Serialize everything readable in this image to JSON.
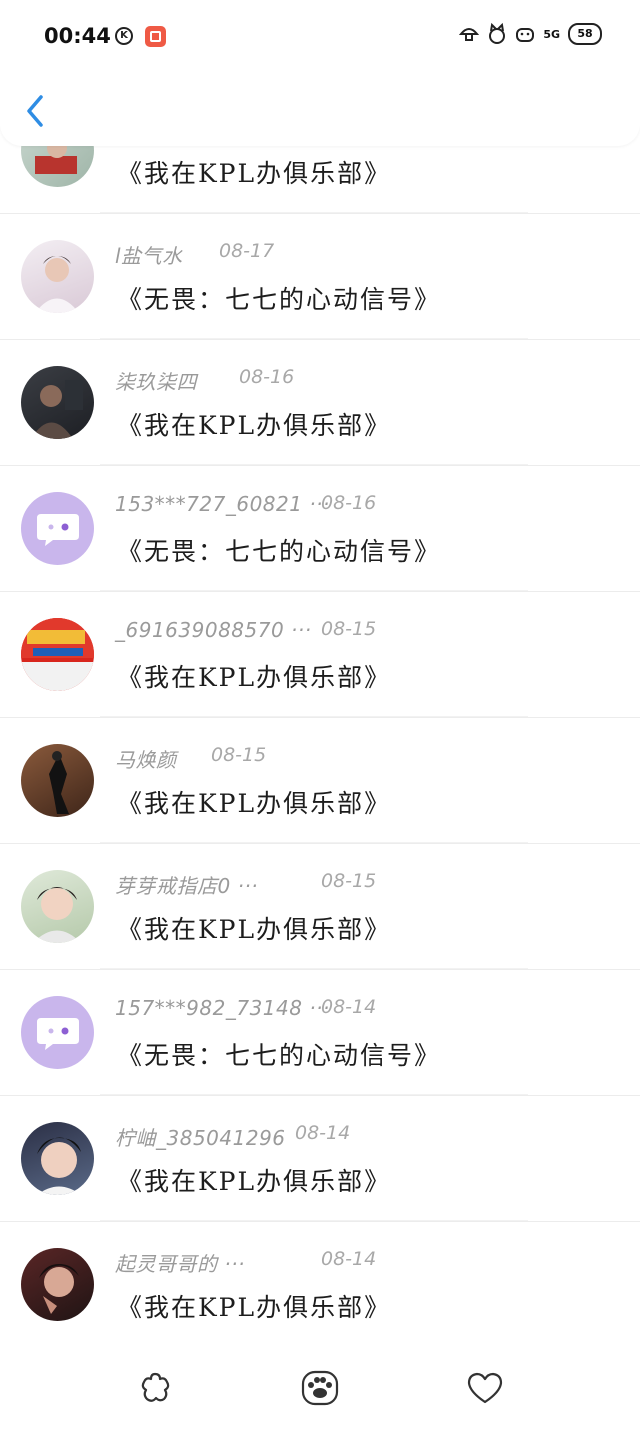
{
  "status": {
    "time": "00:44",
    "k_icon": "K",
    "network": "5G",
    "battery": "58"
  },
  "header": {
    "back_icon": "chevron-left-icon"
  },
  "rows": [
    {
      "author": "",
      "date": "",
      "title": "《我在KPL办俱乐部》",
      "avatar": "photo-red"
    },
    {
      "author": "l盐气水",
      "date": "08-17",
      "title": "《无畏：七七的心动信号》",
      "avatar": "photo-pink"
    },
    {
      "author": "柒玖柒四",
      "date": "08-16",
      "title": "《我在KPL办俱乐部》",
      "avatar": "photo-dark"
    },
    {
      "author": "153***727_60821 ···",
      "date": "08-16",
      "title": "《无畏：七七的心动信号》",
      "avatar": "default"
    },
    {
      "author": "_691639088570 ···",
      "date": "08-15",
      "title": "《我在KPL办俱乐部》",
      "avatar": "photo-banner"
    },
    {
      "author": "马焕颜",
      "date": "08-15",
      "title": "《我在KPL办俱乐部》",
      "avatar": "photo-brown"
    },
    {
      "author": "芽芽戒指店0 ···",
      "date": "08-15",
      "title": "《我在KPL办俱乐部》",
      "avatar": "photo-face"
    },
    {
      "author": "157***982_73148 ···",
      "date": "08-14",
      "title": "《无畏：七七的心动信号》",
      "avatar": "default"
    },
    {
      "author": "柠岫_385041296",
      "date": "08-14",
      "title": "《我在KPL办俱乐部》",
      "avatar": "photo-boy"
    },
    {
      "author": "起灵哥哥的 ···",
      "date": "08-14",
      "title": "《我在KPL办俱乐部》",
      "avatar": "photo-man"
    }
  ],
  "nav": [
    {
      "icon": "flower-icon"
    },
    {
      "icon": "paw-icon"
    },
    {
      "icon": "heart-icon"
    }
  ],
  "colors": {
    "accent": "#2f8de4",
    "placeholder_avatar": "#c9b6ec"
  }
}
